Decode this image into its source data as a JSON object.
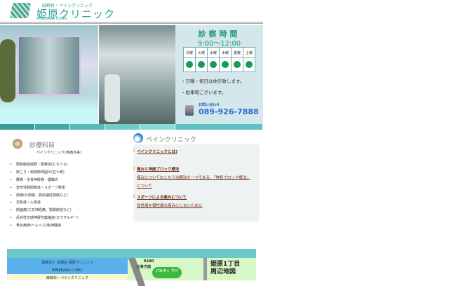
{
  "header": {
    "subtitle": "麻酔科・ペインクリニック",
    "title": "姫原クリニック",
    "title_en": "HIMEBARA CLINIC"
  },
  "hours_panel": {
    "title": "診察時間",
    "hours": "9:00〜12:00",
    "days": [
      "月曜",
      "火曜",
      "水曜",
      "木曜",
      "金曜",
      "土曜"
    ],
    "notes": [
      "・日曜・祝日は休診致します。",
      "・駐車場ございます。"
    ],
    "inquiry_label": "お問い合わせ",
    "phone": "089-926-7888"
  },
  "departments": {
    "title": "診療科目",
    "subtitle": "ペインクリニック(疼痛外来)",
    "items": [
      "頸肩腕症候群・頸椎症(むちうち)",
      "肩こり・肩関節周囲炎(五十肩)",
      "腰痛・坐骨神経痛・腱鞘炎",
      "変形性膝関節症・スポーツ障害",
      "頭痛(片頭痛、筋収縮性頭痛など)",
      "花粉症・心身症",
      "顔面痛(三叉神経痛、顎関節症など)",
      "反射性交感神経性萎縮症(カウザルギー)",
      "帯状疱疹(ヘルペス)後神経痛"
    ]
  },
  "pain_clinic": {
    "title": "ペインクリニック",
    "links": [
      "ペインクリニックとは?",
      "痛みと神経ブロック療法",
      "痛みについておこなう治療法の一つである、「神経ブロック療法」",
      "について",
      "スポーツによる痛みについて",
      "急性痛を慢性痛な痛みにしないために"
    ]
  },
  "footer": {
    "org": "医療法人 青朝会 姫原クリニック",
    "en": "HIMEBARA CLINIC",
    "dept": "麻酔科・ペインクリニック"
  },
  "map": {
    "route": "R180",
    "direction": "北条方面",
    "landmark": "パルティ フジ",
    "title": "姫原1丁目 周辺地図"
  },
  "colors": {
    "accent": "#2aa39a",
    "nav": "#4bb3b0",
    "dot": "#169a55"
  }
}
